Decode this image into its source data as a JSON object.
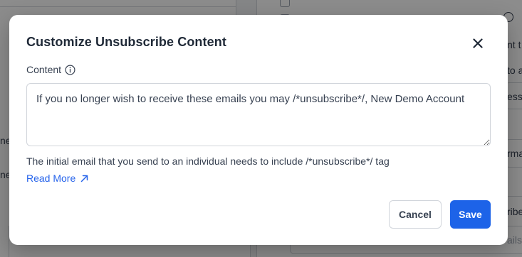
{
  "modal": {
    "title": "Customize Unsubscribe Content",
    "close_icon": "close-icon",
    "content_label": "Content",
    "info_icon": "info-icon",
    "content_value": "If you no longer wish to receive these emails you may /*unsubscribe*/, New Demo Account",
    "help_text": "The initial email that you send to an individual needs to include /*unsubscribe*/ tag",
    "read_more_label": "Read More",
    "read_more_icon": "arrow-up-right-icon",
    "cancel_label": "Cancel",
    "save_label": "Save"
  },
  "background": {
    "right_fragments": [
      "nt t",
      "to a",
      "ess",
      "rma",
      "ribe",
      "ails"
    ],
    "left_fragments": [
      "ne",
      "ne"
    ]
  },
  "colors": {
    "accent": "#1d63e8",
    "link": "#2563eb",
    "overlay": "rgba(0,0,0,0.45)"
  }
}
